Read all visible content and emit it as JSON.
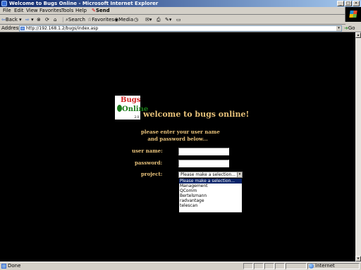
{
  "window": {
    "title": "Welcome to Bugs Online - Microsoft Internet Explorer"
  },
  "menu": {
    "items": [
      "File",
      "Edit",
      "View",
      "Favorites",
      "Tools",
      "Help"
    ],
    "send": "Send"
  },
  "toolbar": {
    "back": "Back",
    "search": "Search",
    "favorites": "Favorites",
    "media": "Media"
  },
  "address": {
    "label": "Address",
    "url": "http://192.168.1.2/bugs/index.asp",
    "go": "Go"
  },
  "page": {
    "logo": {
      "line1": "Bugs",
      "line2": "Online",
      "version": "2.0"
    },
    "welcome": "welcome to bugs online!",
    "instructions": [
      "please enter your user name",
      "and password below..."
    ],
    "form": {
      "username_label": "user name:",
      "password_label": "password:",
      "project_label": "project:",
      "username_value": "",
      "password_value": "",
      "project_selected": "Please make a selection...",
      "project_options": [
        "Please make a selection...",
        "Management",
        "QComm",
        "Bertelsmann",
        "radvantage",
        "telescan"
      ]
    }
  },
  "status": {
    "left": "Done",
    "zone": "Internet"
  }
}
